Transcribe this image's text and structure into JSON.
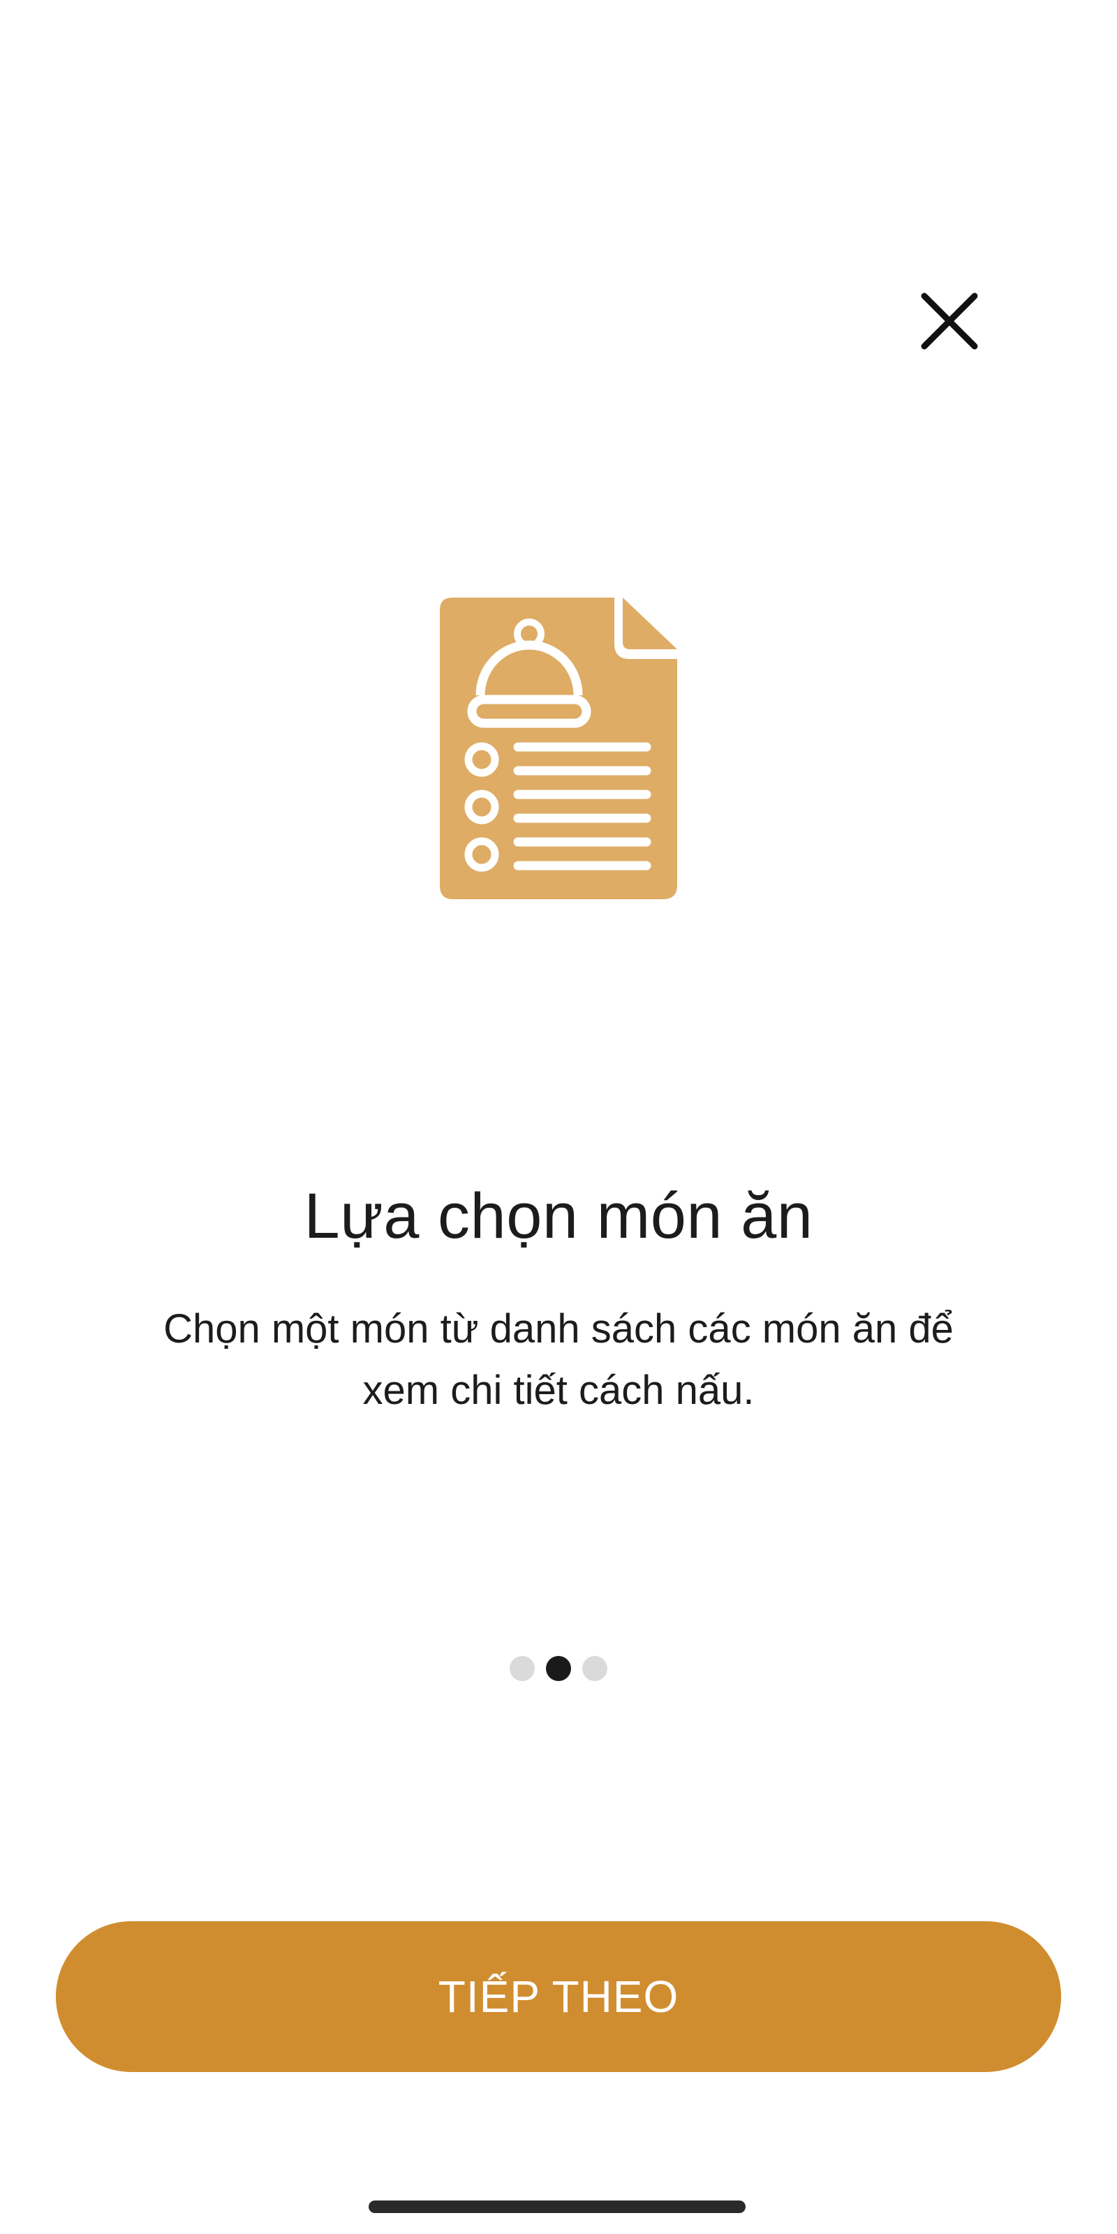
{
  "onboarding": {
    "close_icon": "close-icon",
    "illustration_icon": "recipe-document-icon",
    "title": "Lựa chọn món ăn",
    "description": "Chọn một món từ danh sách các món ăn để xem chi tiết cách nấu.",
    "pager": {
      "total": 3,
      "active_index": 1
    },
    "next_button_label": "TIẾP THEO"
  },
  "colors": {
    "accent": "#D08D30",
    "illustration": "#DEAC65",
    "dot_inactive": "#DADADA",
    "dot_active": "#1A1A1A",
    "text": "#1C1C1C"
  }
}
